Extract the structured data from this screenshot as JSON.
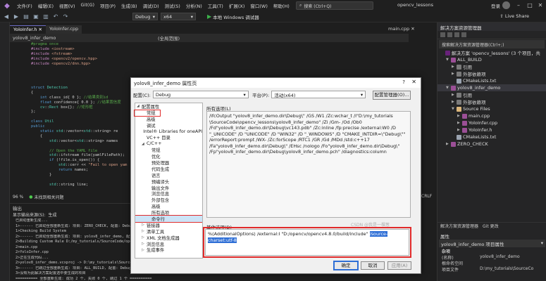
{
  "menu": {
    "items": [
      "文件(F)",
      "编辑(E)",
      "视图(V)",
      "Git(G)",
      "项目(P)",
      "生成(B)",
      "调试(D)",
      "测试(S)",
      "分析(N)",
      "工具(T)",
      "扩展(X)",
      "窗口(W)",
      "帮助(H)"
    ],
    "search_placeholder": "搜索 (Ctrl+Q)",
    "solution_name": "opencv_lessons",
    "signin": "登录",
    "liveshare": "Live Share"
  },
  "toolbar": {
    "config": "Debug",
    "platform": "x64",
    "run_label": "本地 Windows 调试器"
  },
  "editor": {
    "tabs": [
      "YoloInfer.h",
      "YoloInfer.cpp"
    ],
    "right_tab": "main.cpp",
    "nav_left": "yolov8_infer_demo",
    "nav_mid": "(全局范围)",
    "code_lines": [
      [
        [
          "cm",
          "#pragma once"
        ]
      ],
      [
        [
          "pp",
          "#include "
        ],
        [
          "str",
          "<iostream>"
        ]
      ],
      [
        [
          "pp",
          "#include "
        ],
        [
          "str",
          "<fstream>"
        ]
      ],
      [
        [
          "pp",
          "#include "
        ],
        [
          "str",
          "<opencv2/opencv.hpp>"
        ]
      ],
      [
        [
          "pp",
          "#include "
        ],
        [
          "str",
          "<opencv2/dnn.hpp>"
        ]
      ],
      [
        [
          "",
          ""
        ]
      ],
      [
        [
          "",
          ""
        ]
      ],
      [
        [
          "",
          ""
        ]
      ],
      [
        [
          "",
          ""
        ]
      ],
      [
        [
          "kw",
          "struct "
        ],
        [
          "ty",
          "Detection"
        ]
      ],
      [
        [
          "",
          "{"
        ]
      ],
      [
        [
          "",
          "    "
        ],
        [
          "kw",
          "int "
        ],
        [
          "",
          "class_id{ 0 }; "
        ],
        [
          "cm",
          "//结果类别id"
        ]
      ],
      [
        [
          "",
          "    "
        ],
        [
          "kw",
          "float "
        ],
        [
          "",
          "confidence{ 0.0 }; "
        ],
        [
          "cm",
          "//结果置信度"
        ]
      ],
      [
        [
          "",
          "    "
        ],
        [
          "ty",
          "cv"
        ],
        [
          "",
          "::"
        ],
        [
          "ty",
          "Rect"
        ],
        [
          "",
          " box{}; "
        ],
        [
          "cm",
          "//矩形框"
        ]
      ],
      [
        [
          "",
          "};"
        ]
      ],
      [
        [
          "",
          ""
        ]
      ],
      [
        [
          "kw",
          "class "
        ],
        [
          "ty",
          "Util"
        ]
      ],
      [
        [
          "kw",
          "public"
        ],
        [
          ":"
        ]
      ],
      [
        [
          "",
          "    "
        ],
        [
          "kw",
          "static "
        ],
        [
          "ty",
          "std"
        ],
        [
          "",
          "::vector<"
        ],
        [
          "ty",
          "std"
        ],
        [
          "",
          "::string> re"
        ]
      ],
      [
        [
          "",
          "    {"
        ]
      ],
      [
        [
          "",
          "        "
        ],
        [
          "ty",
          "std"
        ],
        [
          "",
          "::vector<"
        ],
        [
          "ty",
          "std"
        ],
        [
          "",
          "::string> names"
        ]
      ],
      [
        [
          "",
          ""
        ]
      ],
      [
        [
          "",
          "        "
        ],
        [
          "cm",
          "// Open the YAML file"
        ]
      ],
      [
        [
          "",
          "        "
        ],
        [
          "ty",
          "std"
        ],
        [
          "",
          "::ifstream file(yamlFilePath);"
        ]
      ],
      [
        [
          "",
          "        "
        ],
        [
          "kw",
          "if "
        ],
        [
          "",
          "(!file.is_open()) {"
        ]
      ],
      [
        [
          "",
          "            "
        ],
        [
          "ty",
          "std"
        ],
        [
          "",
          "::cerr << "
        ],
        [
          "str",
          "\"Fail to open yam"
        ]
      ],
      [
        [
          "",
          "            "
        ],
        [
          "kw",
          "return "
        ],
        [
          "",
          "names;"
        ]
      ],
      [
        [
          "",
          "        }"
        ]
      ],
      [
        [
          "",
          ""
        ]
      ],
      [
        [
          "",
          "        "
        ],
        [
          "ty",
          "std"
        ],
        [
          "",
          "::string line;"
        ]
      ]
    ],
    "zoom": "96 %",
    "issues": "未找到相关问题",
    "eol": "CRLF"
  },
  "output": {
    "title": "输出",
    "source_label": "显示输出来源(S):",
    "source_value": "生成",
    "lines": [
      "已启动重新生成...",
      "1>------ 已启动全部重新生成: 项目: ZERO_CHECK, 配置: Debug",
      "1>Checking Build System",
      "2>------ 已启动全部重新生成: 项目: yolov8_infer_demo, 配置:",
      "2>Building Custom Rule D:/my_tutorials/SourceCode/opencv_l",
      "2>main.cpp",
      "2>YoloInfer.cpp",
      "2>正在生成代码...",
      "2>yolov8_infer_demo.vcxproj -> D:\\my_tutorials\\SourceCo",
      "3>------ 已跳过全部重新生成: 项目: ALL_BUILD, 配置: Debug",
      "3>没有为此解决方案配置选中要生成的项目",
      "========== 全部重新生成: 成功 2 个, 失败 0 个, 跳过 1 个 =========="
    ]
  },
  "solution": {
    "title": "解决方案资源管理器",
    "search_placeholder": "搜索解决方案资源管理器(Ctrl+;)",
    "tree": [
      {
        "indent": 0,
        "caret": "",
        "icon": "#68217a",
        "label": "解决方案 'opencv_lessons' (3 个项目，共"
      },
      {
        "indent": 1,
        "caret": "▼",
        "icon": "#9b4f96",
        "label": "ALL_BUILD"
      },
      {
        "indent": 2,
        "caret": "▶",
        "icon": "#7a7a7a",
        "label": "引用"
      },
      {
        "indent": 2,
        "caret": "▶",
        "icon": "#7a7a7a",
        "label": "外部依赖项"
      },
      {
        "indent": 2,
        "caret": "",
        "icon": "#9aa3b0",
        "label": "CMakeLists.txt"
      },
      {
        "indent": 1,
        "caret": "▼",
        "icon": "#9b4f96",
        "label": "yolov8_infer_demo"
      },
      {
        "indent": 2,
        "caret": "▶",
        "icon": "#7a7a7a",
        "label": "引用"
      },
      {
        "indent": 2,
        "caret": "▶",
        "icon": "#7a7a7a",
        "label": "外部依赖项"
      },
      {
        "indent": 2,
        "caret": "▼",
        "icon": "#dcb67a",
        "label": "Source Files"
      },
      {
        "indent": 3,
        "caret": "▶",
        "icon": "#9b4f96",
        "label": "main.cpp"
      },
      {
        "indent": 3,
        "caret": "▶",
        "icon": "#9b4f96",
        "label": "YoloInfer.cpp"
      },
      {
        "indent": 3,
        "caret": "▶",
        "icon": "#9b4f96",
        "label": "YoloInfer.h"
      },
      {
        "indent": 2,
        "caret": "",
        "icon": "#9aa3b0",
        "label": "CMakeLists.txt"
      },
      {
        "indent": 1,
        "caret": "▶",
        "icon": "#9b4f96",
        "label": "ZERO_CHECK"
      }
    ],
    "bottom_tabs": [
      "解决方案资源管理器",
      "Git 更改"
    ],
    "props_title": "属性",
    "props_header": "yolov8_infer_demo 项目属性",
    "props_rows": [
      {
        "k": "杂项",
        "v": "",
        "group": true
      },
      {
        "k": "(名称)",
        "v": "yolov8_infer_demo",
        "group": false
      },
      {
        "k": "根命名空间",
        "v": "",
        "group": false
      },
      {
        "k": "项目文件",
        "v": "D:\\my_tutorials\\SourceCo",
        "group": false
      }
    ]
  },
  "dialog": {
    "title": "yolov8_infer_demo 属性页",
    "help": "?",
    "close": "✕",
    "config_label": "配置(C):",
    "config_value": "Debug",
    "platform_label": "平台(P):",
    "platform_value": "活动(x64)",
    "config_manager": "配置管理器(O)...",
    "tree": [
      {
        "indent": 0,
        "caret": "◢",
        "label": "配置属性",
        "sel": false
      },
      {
        "indent": 1,
        "caret": "",
        "label": "常规",
        "sel": false
      },
      {
        "indent": 1,
        "caret": "",
        "label": "高级",
        "sel": false
      },
      {
        "indent": 1,
        "caret": "",
        "label": "调试",
        "sel": false
      },
      {
        "indent": 1,
        "caret": "",
        "label": "Intel® Libraries for oneAPI",
        "sel": false
      },
      {
        "indent": 1,
        "caret": "",
        "label": "VC++ 目录",
        "sel": false
      },
      {
        "indent": 1,
        "caret": "◢",
        "label": "C/C++",
        "sel": false
      },
      {
        "indent": 2,
        "caret": "",
        "label": "常规",
        "sel": false
      },
      {
        "indent": 2,
        "caret": "",
        "label": "优化",
        "sel": false
      },
      {
        "indent": 2,
        "caret": "",
        "label": "预处理器",
        "sel": false
      },
      {
        "indent": 2,
        "caret": "",
        "label": "代码生成",
        "sel": false
      },
      {
        "indent": 2,
        "caret": "",
        "label": "语言",
        "sel": false
      },
      {
        "indent": 2,
        "caret": "",
        "label": "预编译头",
        "sel": false
      },
      {
        "indent": 2,
        "caret": "",
        "label": "输出文件",
        "sel": false
      },
      {
        "indent": 2,
        "caret": "",
        "label": "浏览信息",
        "sel": false
      },
      {
        "indent": 2,
        "caret": "",
        "label": "外部包含",
        "sel": false
      },
      {
        "indent": 2,
        "caret": "",
        "label": "高级",
        "sel": false
      },
      {
        "indent": 2,
        "caret": "",
        "label": "所有选项",
        "sel": false
      },
      {
        "indent": 2,
        "caret": "",
        "label": "命令行",
        "sel": true
      },
      {
        "indent": 1,
        "caret": "▷",
        "label": "链接器",
        "sel": false
      },
      {
        "indent": 1,
        "caret": "▷",
        "label": "清单工具",
        "sel": false
      },
      {
        "indent": 1,
        "caret": "▷",
        "label": "XML 文档生成器",
        "sel": false
      },
      {
        "indent": 1,
        "caret": "▷",
        "label": "浏览信息",
        "sel": false
      },
      {
        "indent": 1,
        "caret": "▷",
        "label": "生成事件",
        "sel": false
      }
    ],
    "opts_label": "所有选项(L)",
    "opts_lines": [
      "/ifcOutput \"yolov8_infer_demo.dir\\Debug\\\" /GS /W1 /Zc:wchar_t /I\"D:\\my_tutorials",
      "\\SourceCode\\opencv_lessons\\yolov8_infer_demo\" /Zi /Gm- /Od /Ob0",
      "/Fd\"yolov8_infer_demo.dir\\Debug\\vc143.pdb\" /Zc:inline /fp:precise /external:W0 /D",
      "\"_UNICODE\" /D \"UNICODE\" /D \"WIN32\" /D \"_WINDOWS\" /D \"CMAKE_INTDIR=\\\"Debug\\\"\"",
      "/errorReport:prompt /WX- /Zc:forScope /RTC1 /GR /Gd /MDd /std:c++17",
      "/Fa\"yolov8_infer_demo.dir\\Debug\\\" /EHsc /nologo /Fo\"yolov8_infer_demo.dir\\Debug\\\"",
      "/Fp\"yolov8_infer_demo.dir\\Debug\\yolov8_infer_demo.pch\" /diagnostics:column"
    ],
    "extra_label": "其他选项(D)",
    "extra_line1_pre": "%(AdditionalOptions) /external:I \"D:/opencv/opencv4.8.0/build/include\" ",
    "extra_line1_hl": "/source-",
    "extra_line2_hl": "charset:utf-8",
    "watermark": "CSDN @我是一棵葱",
    "ok": "确定",
    "cancel": "取消",
    "apply": "应用(A)"
  }
}
